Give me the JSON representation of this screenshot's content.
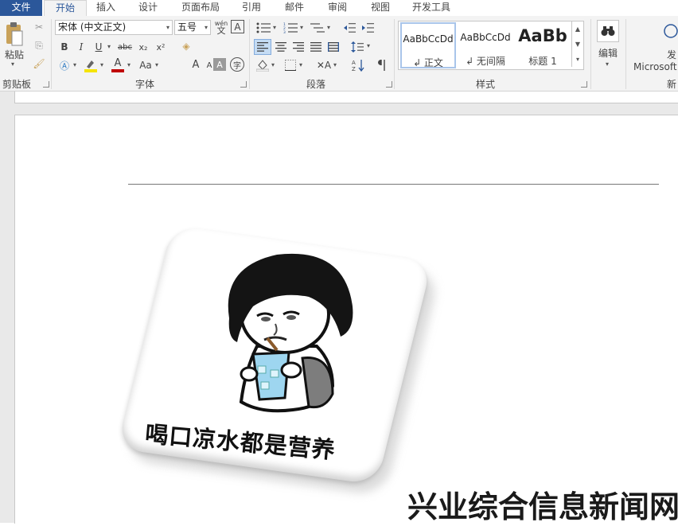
{
  "tabs": [
    "文件",
    "开始",
    "插入",
    "设计",
    "页面布局",
    "引用",
    "邮件",
    "审阅",
    "视图",
    "开发工具"
  ],
  "ribbon": {
    "clipboard": {
      "paste_label": "粘贴",
      "group_label": "剪贴板"
    },
    "font": {
      "font_name": "宋体 (中文正文)",
      "font_size": "五号",
      "phonetic_glyph": "wén",
      "phonetic_char": "文",
      "border_char_glyph": "A",
      "bold": "B",
      "italic": "I",
      "underline": "U",
      "strike": "abc",
      "subscript": "x₂",
      "superscript": "x²",
      "grow": "A",
      "shrink": "A",
      "case": "Aa",
      "shade_char": "A",
      "enclose_char": "字",
      "font_color_char": "A",
      "group_label": "字体"
    },
    "paragraph": {
      "group_label": "段落"
    },
    "styles": {
      "items": [
        {
          "sample": "AaBbCcDd",
          "name": "↲ 正文"
        },
        {
          "sample": "AaBbCcDd",
          "name": "↲ 无间隔"
        },
        {
          "sample": "AaBb",
          "name": "标题 1"
        }
      ],
      "group_label": "样式"
    },
    "editing": {
      "label": "编辑"
    },
    "extra": {
      "label1": "发",
      "label2": "Microsoft",
      "label3": "新"
    }
  },
  "document": {
    "meme_caption": "喝口凉水都是营养"
  },
  "watermark": "兴业综合信息新闻网",
  "colors": {
    "accent": "#2b579a",
    "highlight": "#f5e400",
    "font_color": "#c00000"
  }
}
